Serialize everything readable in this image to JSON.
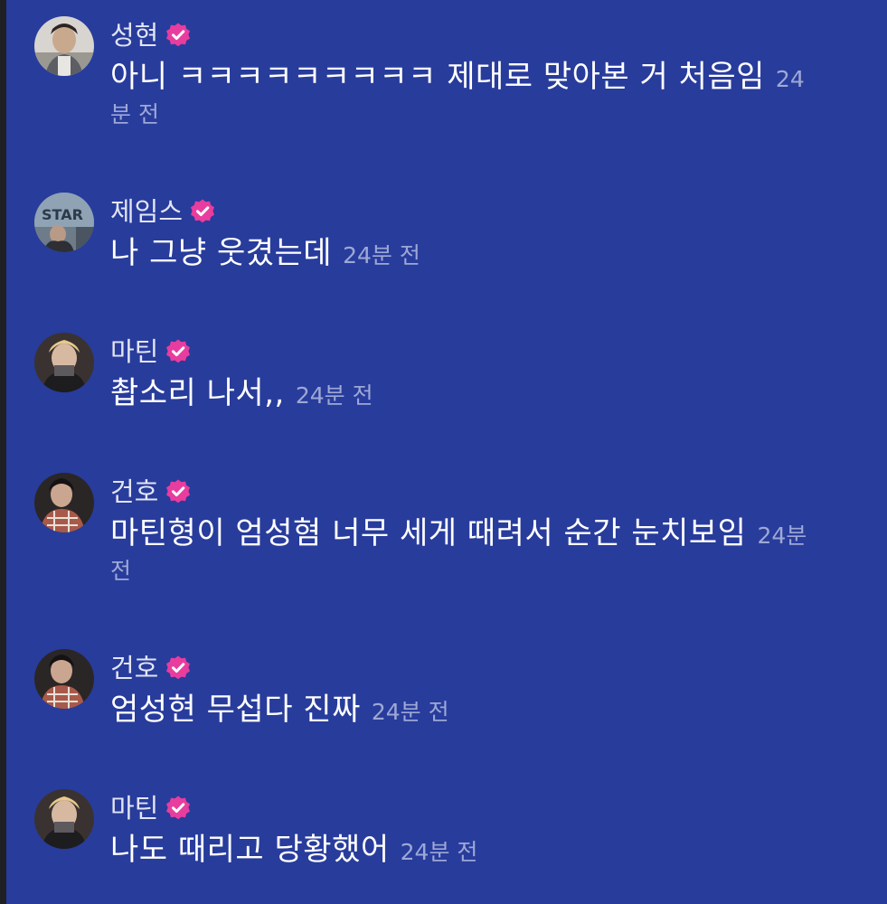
{
  "colors": {
    "background": "#283c9c",
    "badge": "#e83d9e",
    "name": "#e2e5f3",
    "text": "#ffffff",
    "time": "#9ea8d6"
  },
  "messages": [
    {
      "author": "성현",
      "verified_icon": "verified-badge-icon",
      "text": "아니 ㅋㅋㅋㅋㅋㅋㅋㅋㅋ 제대로 맞아본 거 처음임",
      "time_head": "24",
      "time_tail": "분 전"
    },
    {
      "author": "제임스",
      "verified_icon": "verified-badge-icon",
      "text": "나 그냥 웃겼는데",
      "time": "24분 전"
    },
    {
      "author": "마틴",
      "verified_icon": "verified-badge-icon",
      "text": "촵소리 나서,,",
      "time": "24분 전"
    },
    {
      "author": "건호",
      "verified_icon": "verified-badge-icon",
      "text": "마틴형이 엄성혐 너무 세게 때려서 순간 눈치보임",
      "time_head": "24분",
      "time_tail": "전"
    },
    {
      "author": "건호",
      "verified_icon": "verified-badge-icon",
      "text": "엄성현 무섭다 진짜",
      "time": "24분 전"
    },
    {
      "author": "마틴",
      "verified_icon": "verified-badge-icon",
      "text": "나도 때리고 당황했어",
      "time": "24분 전"
    }
  ]
}
